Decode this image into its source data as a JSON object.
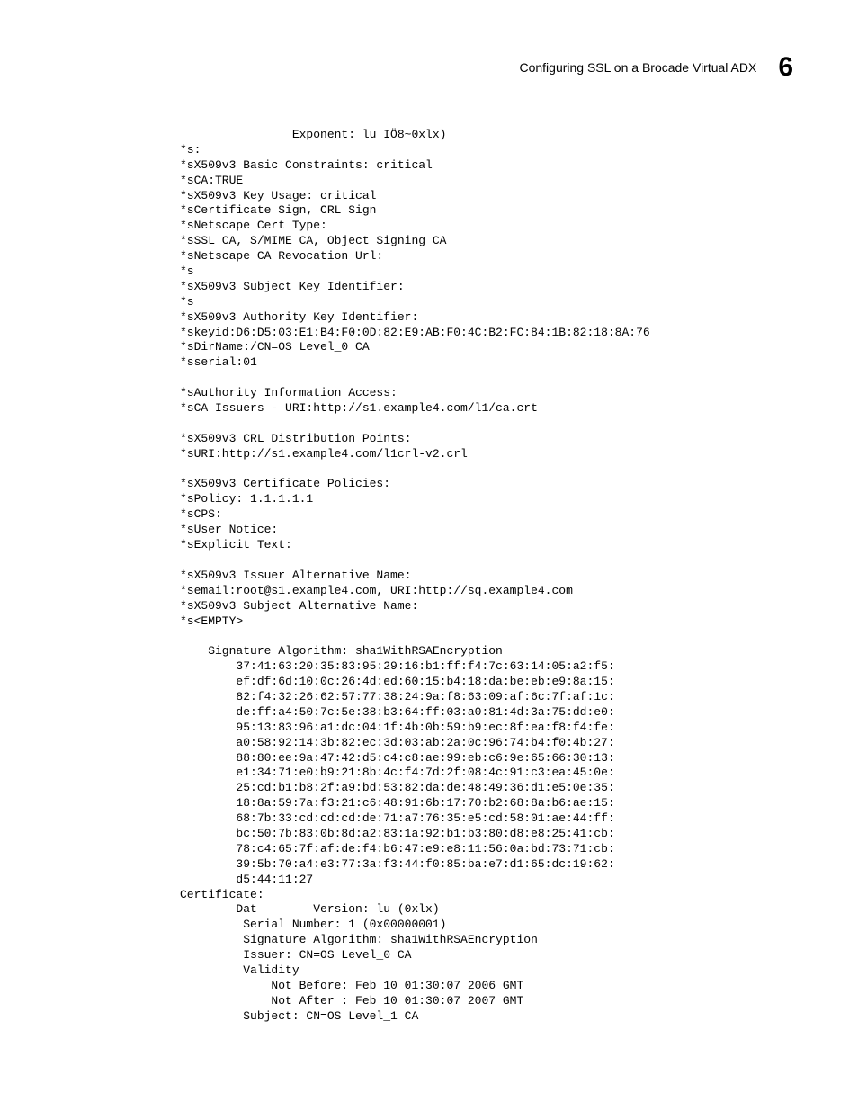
{
  "header": {
    "title": "Configuring SSL on a Brocade Virtual ADX",
    "chapter": "6"
  },
  "code": "                Exponent: lu IÖ8~0xlx)\n*s:\n*sX509v3 Basic Constraints: critical\n*sCA:TRUE\n*sX509v3 Key Usage: critical\n*sCertificate Sign, CRL Sign\n*sNetscape Cert Type:\n*sSSL CA, S/MIME CA, Object Signing CA\n*sNetscape CA Revocation Url:\n*s\n*sX509v3 Subject Key Identifier:\n*s\n*sX509v3 Authority Key Identifier:\n*skeyid:D6:D5:03:E1:B4:F0:0D:82:E9:AB:F0:4C:B2:FC:84:1B:82:18:8A:76\n*sDirName:/CN=OS Level_0 CA\n*sserial:01\n\n*sAuthority Information Access:\n*sCA Issuers - URI:http://s1.example4.com/l1/ca.crt\n\n*sX509v3 CRL Distribution Points:\n*sURI:http://s1.example4.com/l1crl-v2.crl\n\n*sX509v3 Certificate Policies:\n*sPolicy: 1.1.1.1.1\n*sCPS:\n*sUser Notice:\n*sExplicit Text:\n\n*sX509v3 Issuer Alternative Name:\n*semail:root@s1.example4.com, URI:http://sq.example4.com\n*sX509v3 Subject Alternative Name:\n*s<EMPTY>\n\n    Signature Algorithm: sha1WithRSAEncryption\n        37:41:63:20:35:83:95:29:16:b1:ff:f4:7c:63:14:05:a2:f5:\n        ef:df:6d:10:0c:26:4d:ed:60:15:b4:18:da:be:eb:e9:8a:15:\n        82:f4:32:26:62:57:77:38:24:9a:f8:63:09:af:6c:7f:af:1c:\n        de:ff:a4:50:7c:5e:38:b3:64:ff:03:a0:81:4d:3a:75:dd:e0:\n        95:13:83:96:a1:dc:04:1f:4b:0b:59:b9:ec:8f:ea:f8:f4:fe:\n        a0:58:92:14:3b:82:ec:3d:03:ab:2a:0c:96:74:b4:f0:4b:27:\n        88:80:ee:9a:47:42:d5:c4:c8:ae:99:eb:c6:9e:65:66:30:13:\n        e1:34:71:e0:b9:21:8b:4c:f4:7d:2f:08:4c:91:c3:ea:45:0e:\n        25:cd:b1:b8:2f:a9:bd:53:82:da:de:48:49:36:d1:e5:0e:35:\n        18:8a:59:7a:f3:21:c6:48:91:6b:17:70:b2:68:8a:b6:ae:15:\n        68:7b:33:cd:cd:cd:de:71:a7:76:35:e5:cd:58:01:ae:44:ff:\n        bc:50:7b:83:0b:8d:a2:83:1a:92:b1:b3:80:d8:e8:25:41:cb:\n        78:c4:65:7f:af:de:f4:b6:47:e9:e8:11:56:0a:bd:73:71:cb:\n        39:5b:70:a4:e3:77:3a:f3:44:f0:85:ba:e7:d1:65:dc:19:62:\n        d5:44:11:27\nCertificate:\n        Dat        Version: lu (0xlx)\n         Serial Number: 1 (0x00000001)\n         Signature Algorithm: sha1WithRSAEncryption\n         Issuer: CN=OS Level_0 CA\n         Validity\n             Not Before: Feb 10 01:30:07 2006 GMT\n             Not After : Feb 10 01:30:07 2007 GMT\n         Subject: CN=OS Level_1 CA"
}
